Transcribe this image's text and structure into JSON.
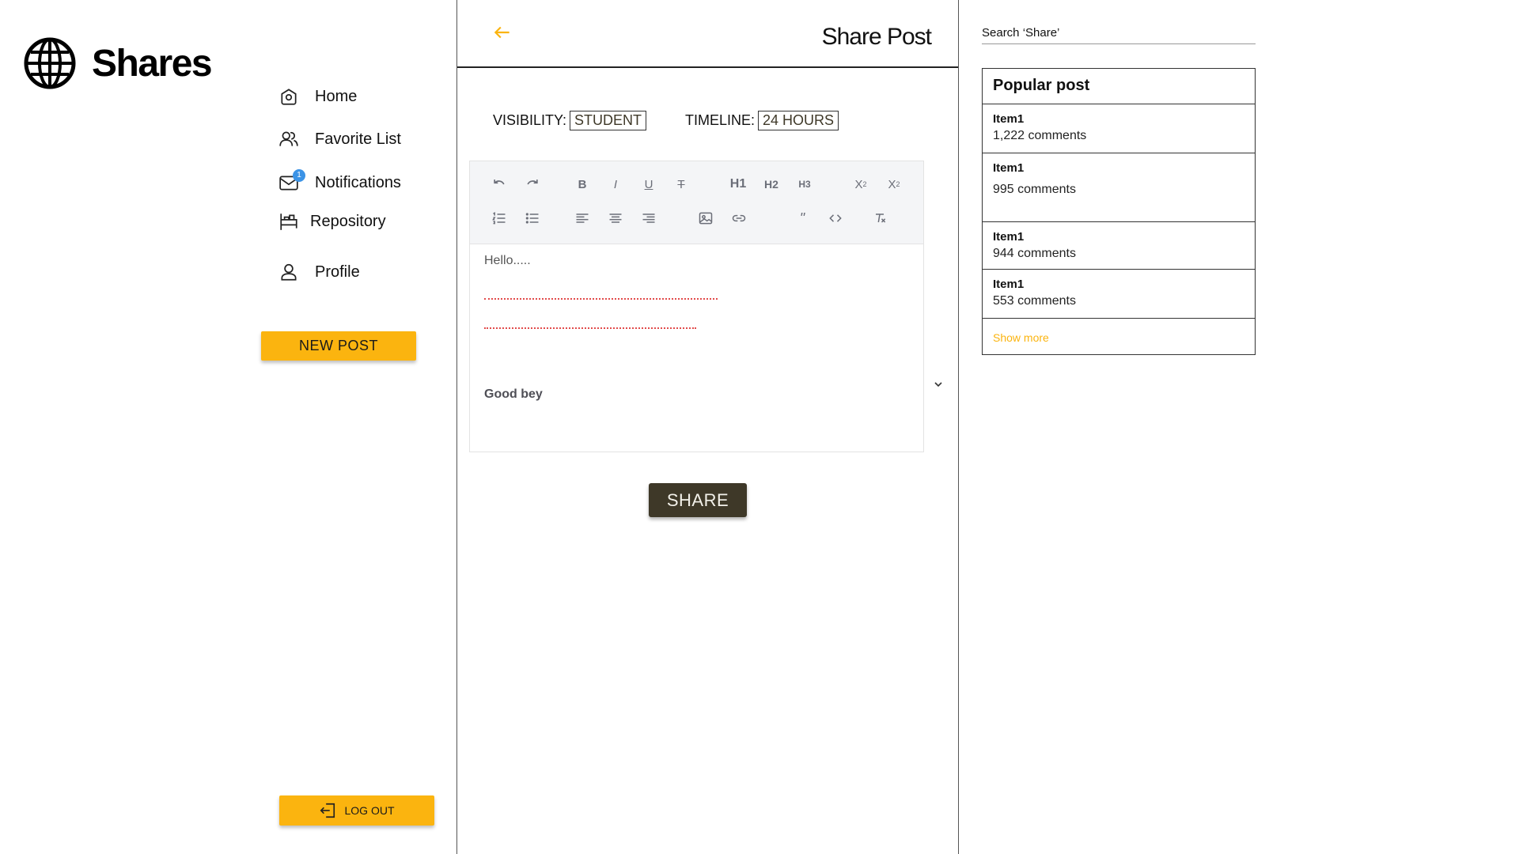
{
  "brand": {
    "name": "Shares"
  },
  "nav": {
    "items": [
      {
        "label": "Home",
        "icon": "home-icon"
      },
      {
        "label": "Favorite List",
        "icon": "users-icon"
      },
      {
        "label": "Notifications",
        "icon": "mail-icon",
        "badge": "1"
      },
      {
        "label": "Repository",
        "icon": "repository-icon"
      },
      {
        "label": "Profile",
        "icon": "user-icon"
      }
    ],
    "new_post_label": "NEW POST",
    "logout_label": "LOG OUT"
  },
  "header": {
    "title": "Share Post"
  },
  "post_settings": {
    "visibility_label": "VISIBILITY:",
    "visibility_value": "STUDENT",
    "timeline_label": "TIMELINE:",
    "timeline_value": "24 HOURS"
  },
  "editor": {
    "toolbar_row1": [
      "undo-icon",
      "redo-icon",
      "B",
      "I",
      "U",
      "T",
      "H1",
      "H2",
      "H3",
      "subscript",
      "superscript"
    ],
    "toolbar_row2": [
      "ordered-list-icon",
      "bullet-list-icon",
      "align-left-icon",
      "align-center-icon",
      "align-right-icon",
      "image-icon",
      "link-icon",
      "quote-icon",
      "code-icon",
      "clear-format-icon"
    ],
    "line1": "Hello.....",
    "line_last": "Good bey"
  },
  "share_label": "SHARE",
  "search": {
    "placeholder": "Search ‘Share’"
  },
  "popular": {
    "title": "Popular post",
    "items": [
      {
        "title": "Item1",
        "comments": "1,222 comments"
      },
      {
        "title": "Item1",
        "comments": "995 comments"
      },
      {
        "title": "Item1",
        "comments": "944 comments"
      },
      {
        "title": "Item1",
        "comments": "553 comments"
      }
    ],
    "show_more": "Show more"
  },
  "colors": {
    "accent": "#fbb40f",
    "dark_button": "#3e3828",
    "badge": "#3b93e6",
    "spell_error": "#e24b4b"
  }
}
